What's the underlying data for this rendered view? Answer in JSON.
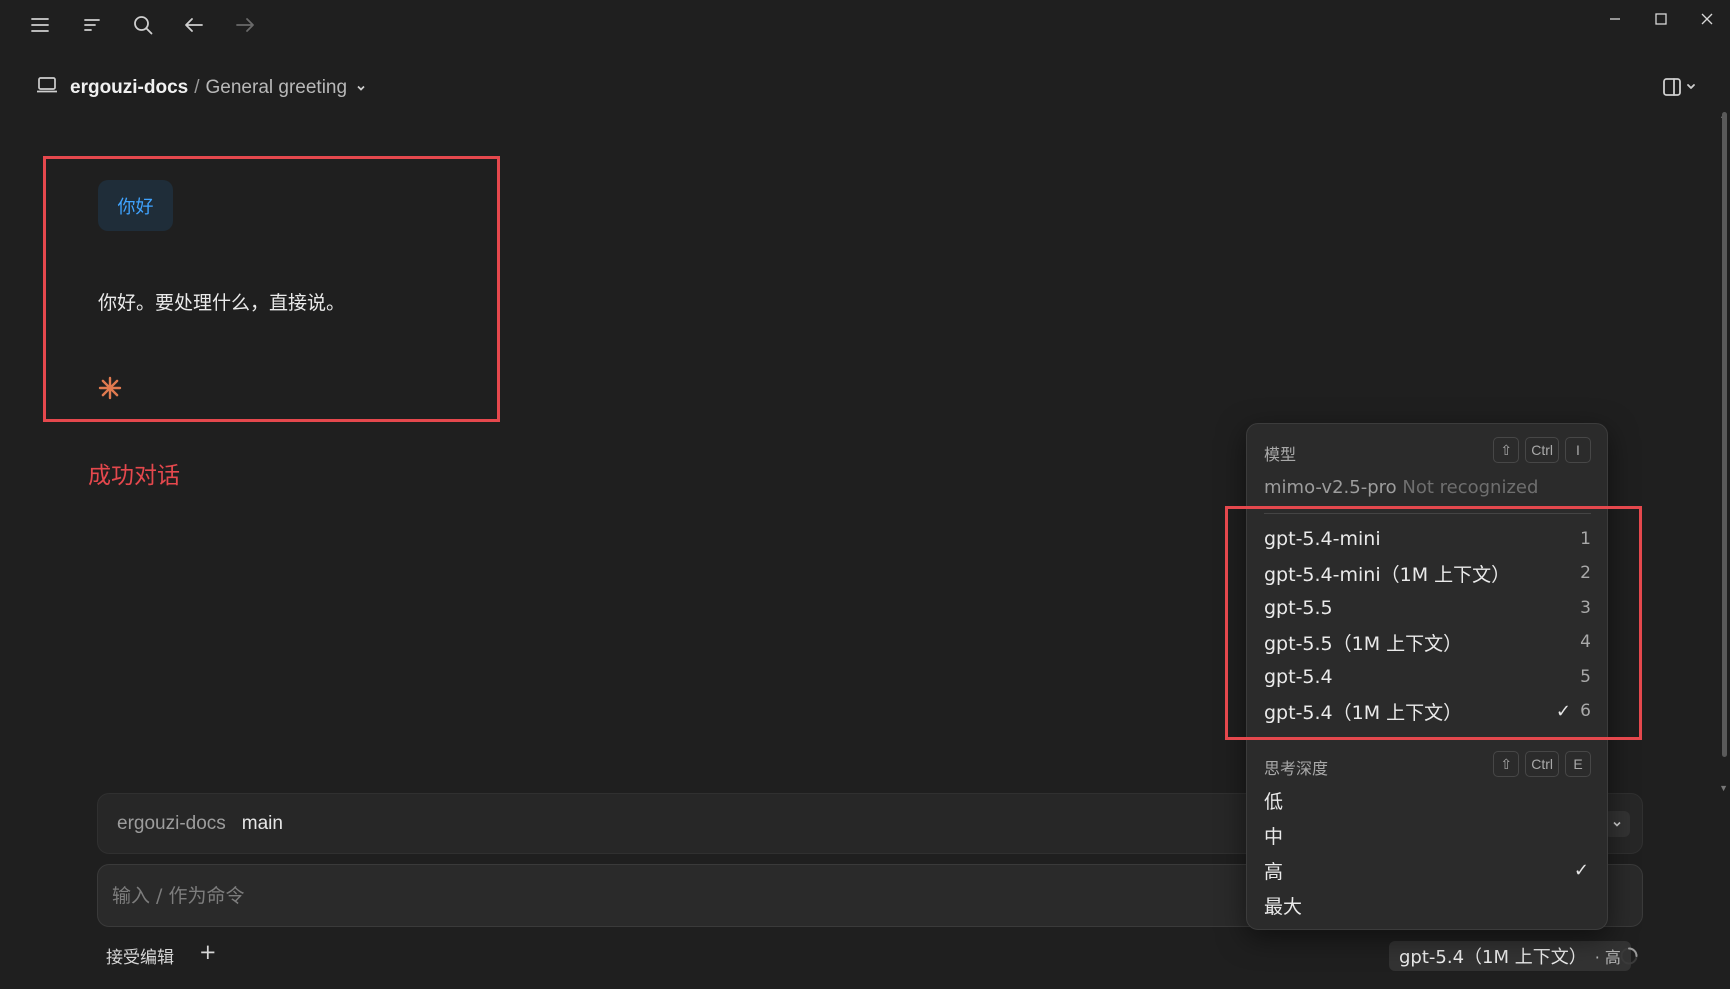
{
  "breadcrumb": {
    "project": "ergouzi-docs",
    "separator": "/",
    "conversation": "General greeting"
  },
  "conversation": {
    "user_message": "你好",
    "assistant_message": "你好。要处理什么，直接说。"
  },
  "annotation": {
    "label": "成功对话",
    "color": "#e5484d"
  },
  "context_bar": {
    "repo": "ergouzi-docs",
    "branch": "main"
  },
  "input": {
    "placeholder": "输入 / 作为命令",
    "value": ""
  },
  "footer": {
    "accept_edits": "接受编辑",
    "add_label": "+",
    "model": "gpt-5.4（1M 上下文）",
    "level": "· 高"
  },
  "menu": {
    "model_section": {
      "title": "模型",
      "shortcut": [
        "⇧",
        "Ctrl",
        "I"
      ],
      "current_model": "mimo-v2.5-pro",
      "current_status": "Not recognized",
      "items": [
        {
          "label": "gpt-5.4-mini",
          "num": "1",
          "checked": false
        },
        {
          "label": "gpt-5.4-mini（1M 上下文）",
          "num": "2",
          "checked": false
        },
        {
          "label": "gpt-5.5",
          "num": "3",
          "checked": false
        },
        {
          "label": "gpt-5.5（1M 上下文）",
          "num": "4",
          "checked": false
        },
        {
          "label": "gpt-5.4",
          "num": "5",
          "checked": false
        },
        {
          "label": "gpt-5.4（1M 上下文）",
          "num": "6",
          "checked": true
        }
      ]
    },
    "depth_section": {
      "title": "思考深度",
      "shortcut": [
        "⇧",
        "Ctrl",
        "E"
      ],
      "items": [
        {
          "label": "低",
          "checked": false
        },
        {
          "label": "中",
          "checked": false
        },
        {
          "label": "高",
          "checked": true
        },
        {
          "label": "最大",
          "checked": false
        }
      ]
    },
    "check_glyph": "✓"
  },
  "colors": {
    "background": "#1f1f1f",
    "accent_blue": "#3fa3ff",
    "spark_orange": "#e07a4f",
    "annotation_red": "#e5484d"
  },
  "icons": [
    "menu-icon",
    "outline-icon",
    "search-icon",
    "back-icon",
    "forward-icon",
    "minimize-icon",
    "maximize-icon",
    "close-icon",
    "laptop-icon",
    "chevron-down-icon",
    "panel-toggle-icon",
    "spark-icon",
    "plus-icon",
    "loading-spinner-icon"
  ]
}
